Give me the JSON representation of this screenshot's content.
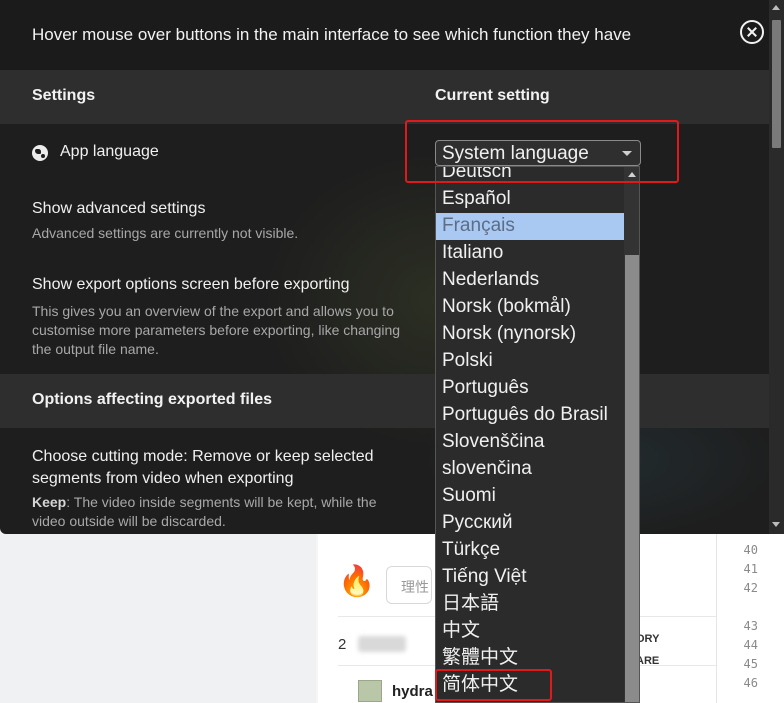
{
  "modal": {
    "hint": "Hover mouse over buttons in the main interface to see which function they have",
    "header": {
      "settings": "Settings",
      "current_setting": "Current setting"
    },
    "rows": {
      "app_language": {
        "title": "App language"
      },
      "advanced": {
        "title": "Show advanced settings",
        "desc": "Advanced settings are currently not visible."
      },
      "export_options": {
        "title": "Show export options screen before exporting",
        "desc": "This gives you an overview of the export and allows you to customise more parameters before exporting, like changing the output file name."
      },
      "cutting_mode": {
        "title": "Choose cutting mode: Remove or keep selected segments from video when exporting",
        "desc_bold": "Keep",
        "desc": ": The video inside segments will be kept, while the video outside will be discarded."
      }
    },
    "section2_header": "Options affecting exported files"
  },
  "language_select": {
    "value": "System language",
    "options": [
      "Deutsch",
      "Español",
      "Français",
      "Italiano",
      "Nederlands",
      "Norsk (bokmål)",
      "Norsk (nynorsk)",
      "Polski",
      "Português",
      "Português do Brasil",
      "Slovenščina",
      "slovenčina",
      "Suomi",
      "Русский",
      "Türkçe",
      "Tiếng Việt",
      "日本語",
      "中文",
      "繁體中文",
      "简体中文"
    ],
    "highlighted_option": "Français"
  },
  "background": {
    "search_placeholder": "理性",
    "user_two": "2",
    "username": "hydra",
    "tags": [
      "ORY",
      "ARE"
    ],
    "line_numbers": [
      "40",
      "41",
      "42",
      "43",
      "44",
      "45",
      "46"
    ]
  },
  "colors": {
    "highlight_red": "#e0191a",
    "selected_option_bg": "#a9c9f3",
    "modal_bg": "#1e1e1e"
  },
  "icons": {
    "language": "globe-icon",
    "close": "close-icon",
    "fire": "fire-icon"
  }
}
